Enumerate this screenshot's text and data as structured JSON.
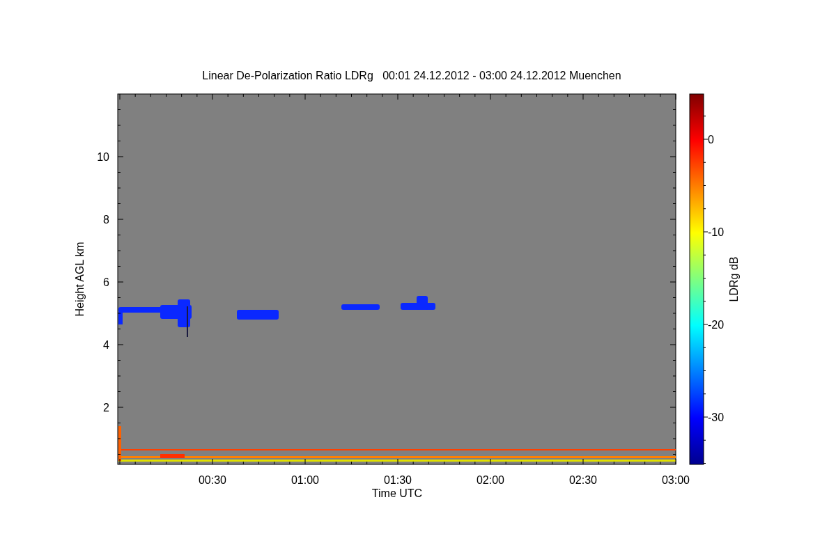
{
  "title": "Linear De-Polarization Ratio LDRg   00:01 24.12.2012 - 03:00 24.12.2012 Muenchen",
  "plot": {
    "xlabel": "Time UTC",
    "ylabel": "Height AGL km",
    "xticks": [
      "00:30",
      "01:00",
      "01:30",
      "02:00",
      "02:30",
      "03:00"
    ],
    "yticks": [
      "10",
      "8",
      "6",
      "4",
      "2"
    ]
  },
  "colorbar": {
    "label": "LDRg dB",
    "ticks": [
      "0",
      "-10",
      "-20",
      "-30"
    ]
  }
}
